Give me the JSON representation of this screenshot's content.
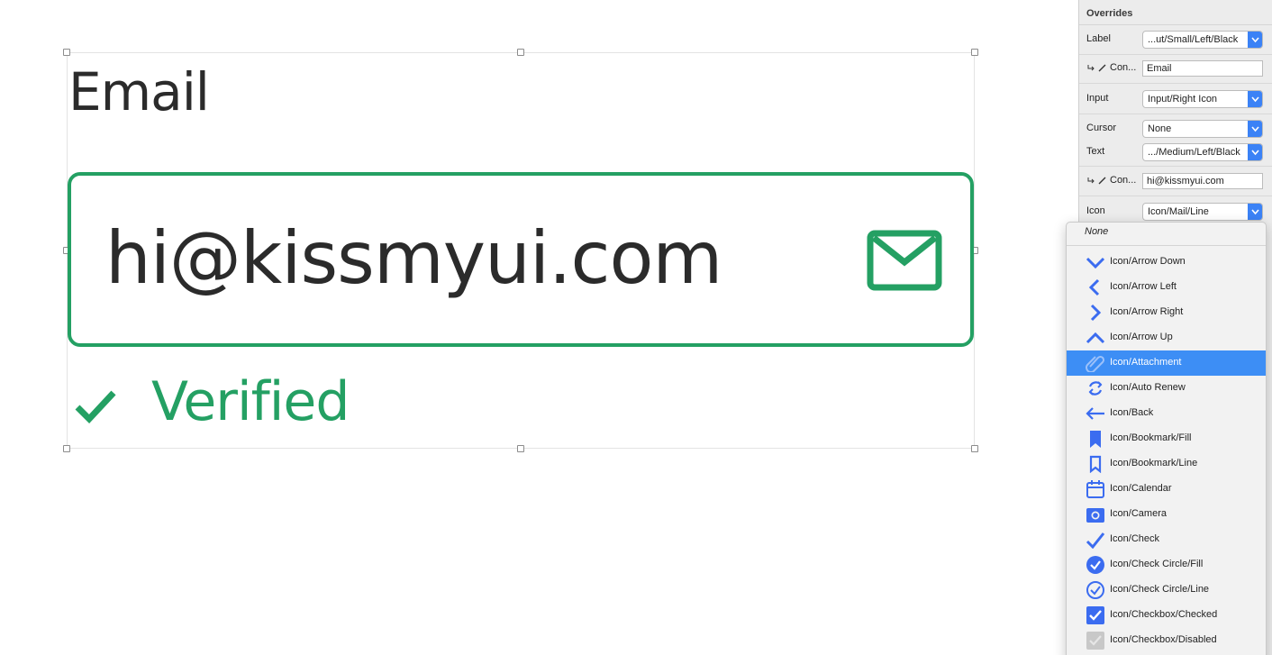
{
  "canvas": {
    "label": "Email",
    "input_value": "hi@kissmyui.com",
    "status_text": "Verified",
    "accent_color": "#24a063",
    "text_color": "#2b2b2b",
    "input_icon": "mail-icon",
    "status_icon": "check-icon"
  },
  "inspector": {
    "title": "Overrides",
    "rows": {
      "label": {
        "name": "Label",
        "value": "...ut/Small/Left/Black"
      },
      "label_content": {
        "name": "Con...",
        "value": "Email"
      },
      "input": {
        "name": "Input",
        "value": "Input/Right Icon"
      },
      "cursor": {
        "name": "Cursor",
        "value": "None"
      },
      "text": {
        "name": "Text",
        "value": ".../Medium/Left/Black"
      },
      "text_content": {
        "name": "Con...",
        "value": "hi@kissmyui.com"
      },
      "icon": {
        "name": "Icon",
        "value": "Icon/Mail/Line"
      }
    }
  },
  "dropdown": {
    "none_label": "None",
    "selected_index": 4,
    "accent_color": "#3d8ef5",
    "icon_color": "#3b6cf0",
    "items": [
      {
        "label": "Icon/Arrow Down",
        "icon": "arrow-down-icon"
      },
      {
        "label": "Icon/Arrow Left",
        "icon": "arrow-left-icon"
      },
      {
        "label": "Icon/Arrow Right",
        "icon": "arrow-right-icon"
      },
      {
        "label": "Icon/Arrow Up",
        "icon": "arrow-up-icon"
      },
      {
        "label": "Icon/Attachment",
        "icon": "attachment-icon"
      },
      {
        "label": "Icon/Auto Renew",
        "icon": "auto-renew-icon"
      },
      {
        "label": "Icon/Back",
        "icon": "back-icon"
      },
      {
        "label": "Icon/Bookmark/Fill",
        "icon": "bookmark-fill-icon"
      },
      {
        "label": "Icon/Bookmark/Line",
        "icon": "bookmark-line-icon"
      },
      {
        "label": "Icon/Calendar",
        "icon": "calendar-icon"
      },
      {
        "label": "Icon/Camera",
        "icon": "camera-icon"
      },
      {
        "label": "Icon/Check",
        "icon": "check-icon"
      },
      {
        "label": "Icon/Check Circle/Fill",
        "icon": "check-circle-fill-icon"
      },
      {
        "label": "Icon/Check Circle/Line",
        "icon": "check-circle-line-icon"
      },
      {
        "label": "Icon/Checkbox/Checked",
        "icon": "checkbox-checked-icon"
      },
      {
        "label": "Icon/Checkbox/Disabled",
        "icon": "checkbox-disabled-icon"
      }
    ]
  }
}
